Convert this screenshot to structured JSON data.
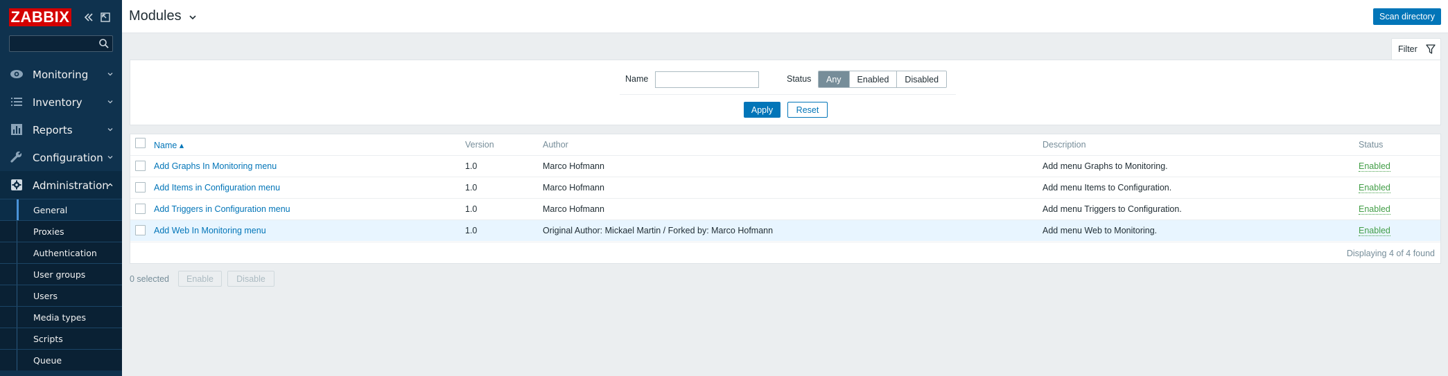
{
  "sidebar": {
    "logo": "ZABBIX",
    "search": {
      "value": "",
      "placeholder": ""
    },
    "menu": [
      {
        "label": "Monitoring",
        "icon": "eye-icon"
      },
      {
        "label": "Inventory",
        "icon": "list-icon"
      },
      {
        "label": "Reports",
        "icon": "bar-chart-icon"
      },
      {
        "label": "Configuration",
        "icon": "wrench-icon"
      },
      {
        "label": "Administration",
        "icon": "gear-icon"
      }
    ],
    "submenu": [
      "General",
      "Proxies",
      "Authentication",
      "User groups",
      "Users",
      "Media types",
      "Scripts",
      "Queue"
    ]
  },
  "header": {
    "title": "Modules",
    "scan_button": "Scan directory"
  },
  "filter": {
    "tab_label": "Filter",
    "name_label": "Name",
    "name_value": "",
    "status_label": "Status",
    "status_options": [
      "Any",
      "Enabled",
      "Disabled"
    ],
    "status_selected": "Any",
    "apply": "Apply",
    "reset": "Reset"
  },
  "table": {
    "columns": [
      "Name ▴",
      "Version",
      "Author",
      "Description",
      "Status"
    ],
    "rows": [
      {
        "name": "Add Graphs In Monitoring menu",
        "version": "1.0",
        "author": "Marco Hofmann",
        "description": "Add menu Graphs to Monitoring.",
        "status": "Enabled"
      },
      {
        "name": "Add Items in Configuration menu",
        "version": "1.0",
        "author": "Marco Hofmann",
        "description": "Add menu Items to Configuration.",
        "status": "Enabled"
      },
      {
        "name": "Add Triggers in Configuration menu",
        "version": "1.0",
        "author": "Marco Hofmann",
        "description": "Add menu Triggers to Configuration.",
        "status": "Enabled"
      },
      {
        "name": "Add Web In Monitoring menu",
        "version": "1.0",
        "author": "Original Author: Mickael Martin / Forked by: Marco Hofmann",
        "description": "Add menu Web to Monitoring.",
        "status": "Enabled"
      }
    ],
    "display_count": "Displaying 4 of 4 found"
  },
  "actions": {
    "selected": "0 selected",
    "enable": "Enable",
    "disable": "Disable"
  },
  "colors": {
    "sidebar_bg": "#0f324e",
    "accent": "#0275b8",
    "logo_red": "#d40000",
    "status_green": "#429e47"
  }
}
